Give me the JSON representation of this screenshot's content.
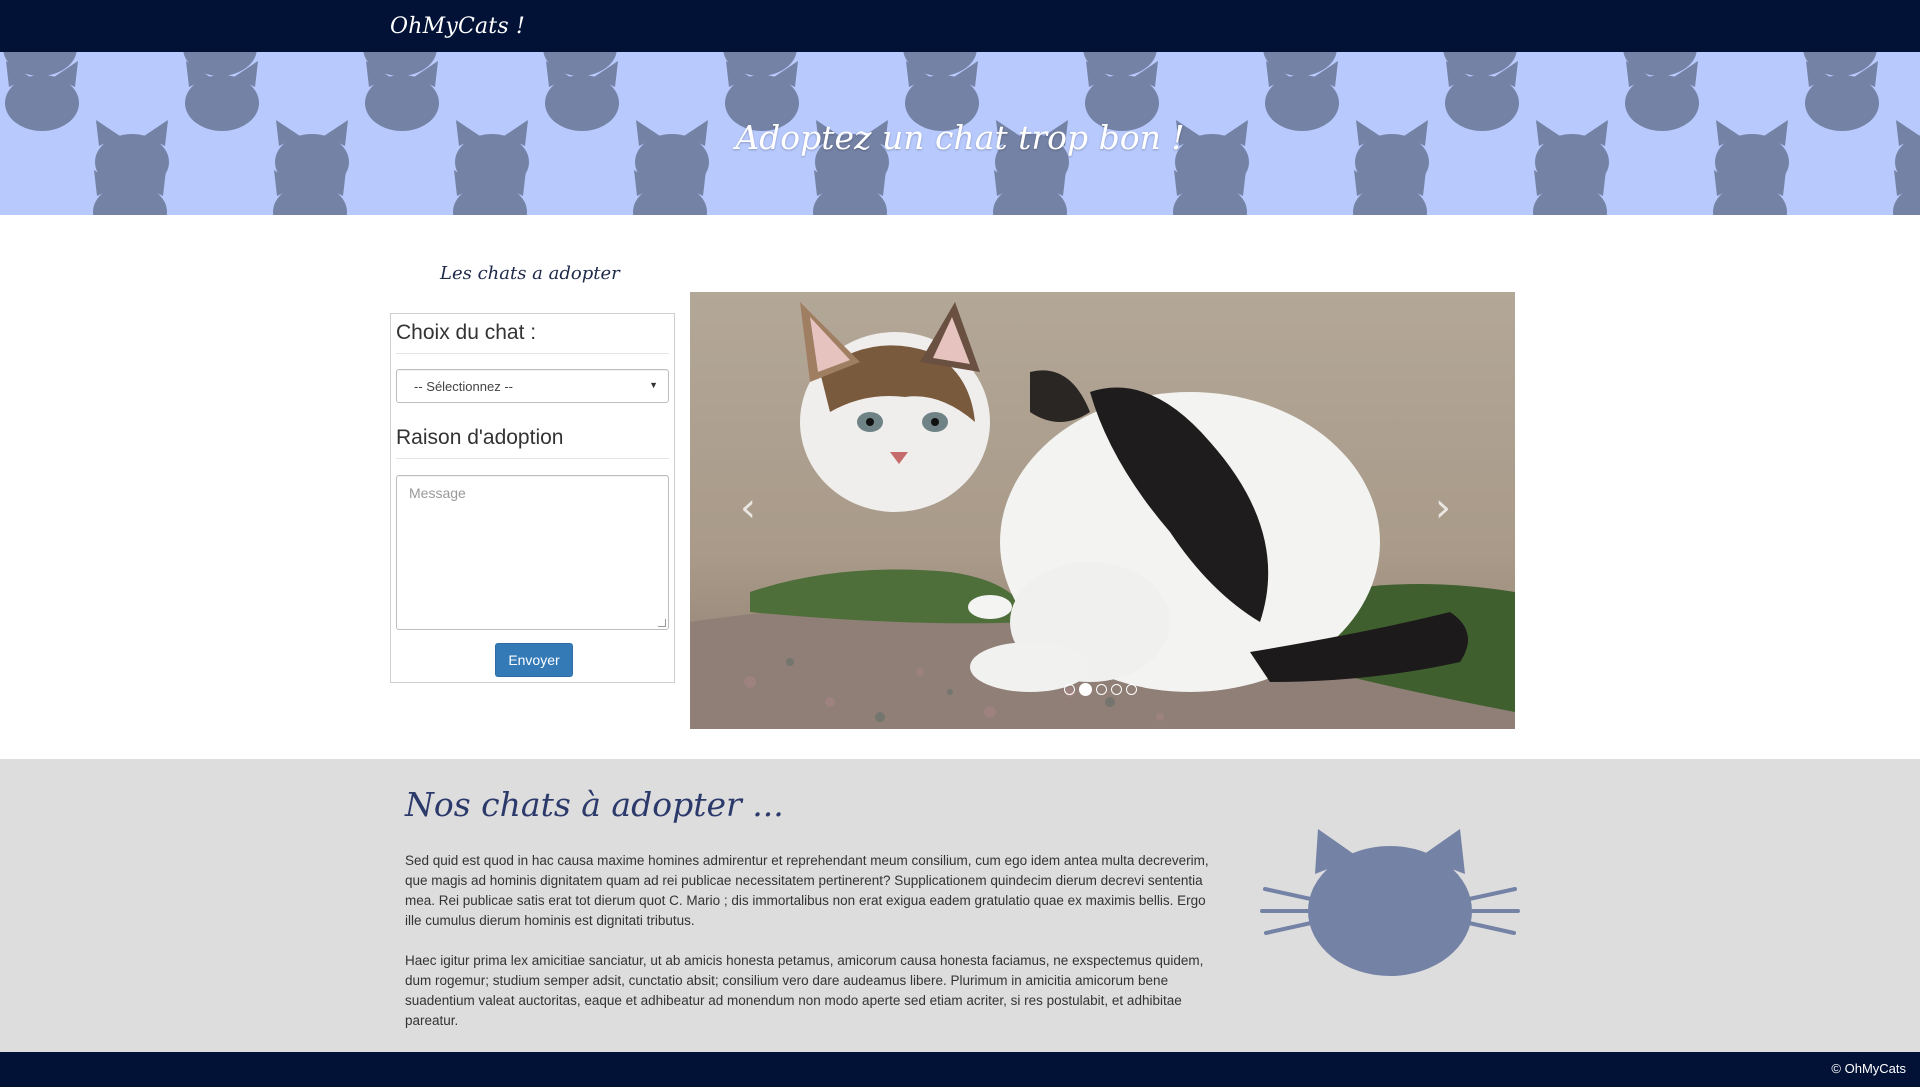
{
  "nav": {
    "brand": "OhMyCats !"
  },
  "hero": {
    "title": "Adoptez un chat trop bon !"
  },
  "adopt_section": {
    "label": "Les chats a adopter",
    "form": {
      "cat_choice_heading": "Choix du chat :",
      "cat_select_value": "-- Sélectionnez --",
      "reason_heading": "Raison d'adoption",
      "message_placeholder": "Message",
      "submit_label": "Envoyer"
    },
    "carousel": {
      "prev_icon": "chevron-left-icon",
      "next_icon": "chevron-right-icon",
      "slide_count": 5,
      "active_slide": 2
    }
  },
  "info": {
    "title": "Nos chats à adopter ...",
    "paragraph_1": "Sed quid est quod in hac causa maxime homines admirentur et reprehendant meum consilium, cum ego idem antea multa decreverim, que magis ad hominis dignitatem quam ad rei publicae necessitatem pertinerent? Supplicationem quindecim dierum decrevi sententia mea. Rei publicae satis erat tot dierum quot C. Mario ; dis immortalibus non erat exigua eadem gratulatio quae ex maximis bellis. Ergo ille cumulus dierum hominis est dignitati tributus.",
    "paragraph_2": "Haec igitur prima lex amicitiae sanciatur, ut ab amicis honesta petamus, amicorum causa honesta faciamus, ne exspectemus quidem, dum rogemur; studium semper adsit, cunctatio absit; consilium vero dare audeamus libere. Plurimum in amicitia amicorum bene suadentium valeat auctoritas, eaque et adhibeatur ad monendum non modo aperte sed etiam acriter, si res postulabit, et adhibitae pareatur.",
    "illustration_icon": "cat-head-icon"
  },
  "footer": {
    "copyright": "© OhMyCats"
  },
  "colors": {
    "navbar": "#021237",
    "hero_bg": "#b8cafd",
    "cat_pattern": "#7482a6",
    "button": "#337ab7",
    "info_bg": "#dddddd",
    "info_title": "#2c3a6b"
  }
}
